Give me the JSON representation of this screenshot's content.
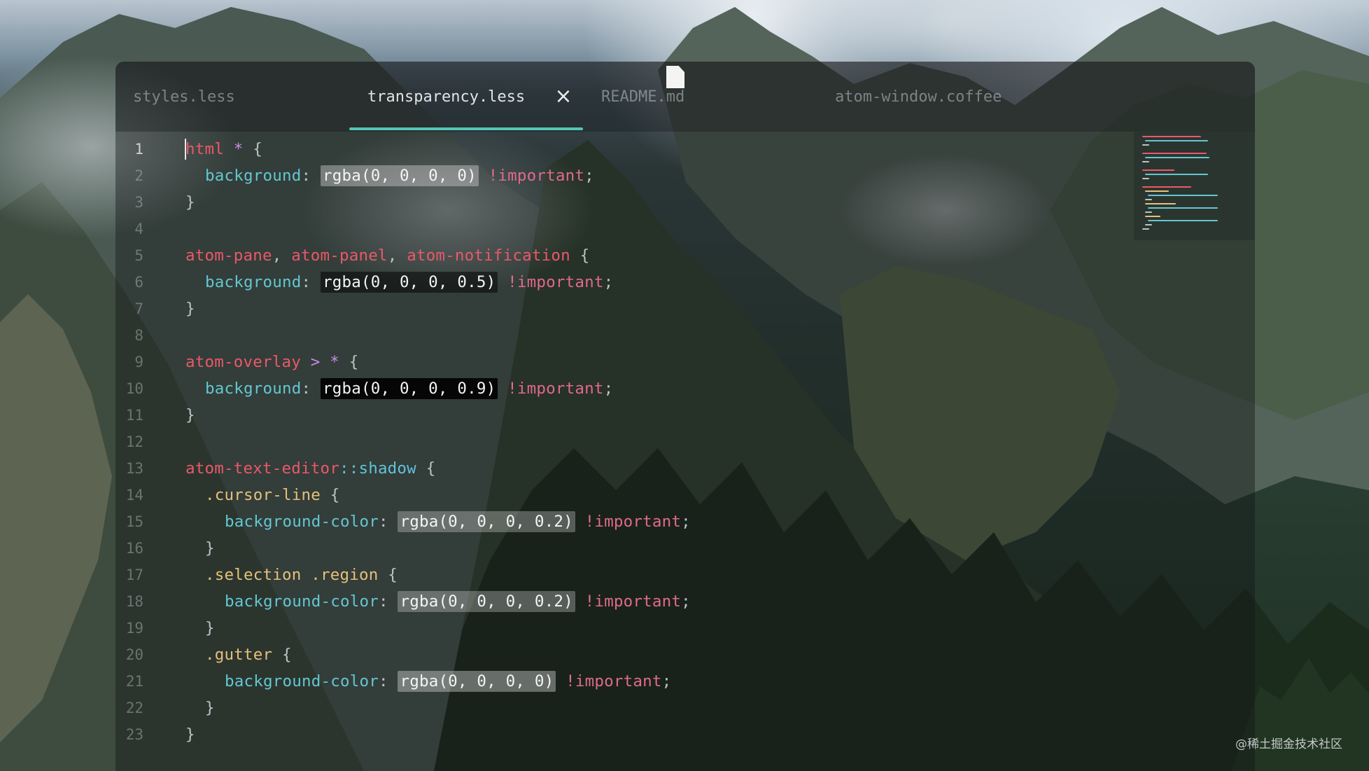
{
  "tabs": [
    {
      "label": "styles.less",
      "active": false
    },
    {
      "label": "transparency.less",
      "active": true
    },
    {
      "label": "README.md",
      "active": false
    },
    {
      "label": "atom-window.coffee",
      "active": false
    }
  ],
  "tab_close_symbol": "×",
  "line_numbers": [
    "1",
    "2",
    "3",
    "4",
    "5",
    "6",
    "7",
    "8",
    "9",
    "10",
    "11",
    "12",
    "13",
    "14",
    "15",
    "16",
    "17",
    "18",
    "19",
    "20",
    "21",
    "22",
    "23"
  ],
  "code": {
    "l1": {
      "sel": "html",
      "star": "*",
      "brace": " {"
    },
    "l2": {
      "prop": "background",
      "colon": ": ",
      "val": "rgba(0, 0, 0, 0)",
      "imp": " !important",
      "semi": ";"
    },
    "l3": {
      "brace": "}"
    },
    "l5": {
      "sel1": "atom-pane",
      "comma1": ", ",
      "sel2": "atom-panel",
      "comma2": ", ",
      "sel3": "atom-notification",
      "brace": " {"
    },
    "l6": {
      "prop": "background",
      "colon": ": ",
      "val": "rgba(0, 0, 0, 0.5)",
      "imp": " !important",
      "semi": ";"
    },
    "l7": {
      "brace": "}"
    },
    "l9": {
      "sel": "atom-overlay",
      "gt": " > ",
      "star": "*",
      "brace": " {"
    },
    "l10": {
      "prop": "background",
      "colon": ": ",
      "val": "rgba(0, 0, 0, 0.9)",
      "imp": " !important",
      "semi": ";"
    },
    "l11": {
      "brace": "}"
    },
    "l13": {
      "sel": "atom-text-editor",
      "pseudo": "::shadow",
      "brace": " {"
    },
    "l14": {
      "cls": ".cursor-line",
      "brace": " {"
    },
    "l15": {
      "prop": "background-color",
      "colon": ": ",
      "val": "rgba(0, 0, 0, 0.2)",
      "imp": " !important",
      "semi": ";"
    },
    "l16": {
      "brace": "}"
    },
    "l17": {
      "cls1": ".selection",
      "cls2": " .region",
      "brace": " {"
    },
    "l18": {
      "prop": "background-color",
      "colon": ": ",
      "val": "rgba(0, 0, 0, 0.2)",
      "imp": " !important",
      "semi": ";"
    },
    "l19": {
      "brace": "}"
    },
    "l20": {
      "cls": ".gutter",
      "brace": " {"
    },
    "l21": {
      "prop": "background-color",
      "colon": ": ",
      "val": "rgba(0, 0, 0, 0)",
      "imp": " !important",
      "semi": ";"
    },
    "l22": {
      "brace": "}"
    },
    "l23": {
      "brace": "}"
    }
  },
  "watermark": "@稀土掘金技术社区",
  "colors": {
    "accent_underline": "#52c6b4",
    "selector": "#e9596a",
    "property": "#63c7d1",
    "important": "#e06a8a",
    "class": "#e5c07b"
  },
  "icons": {
    "tab_close": "close-icon",
    "file": "file-icon"
  }
}
